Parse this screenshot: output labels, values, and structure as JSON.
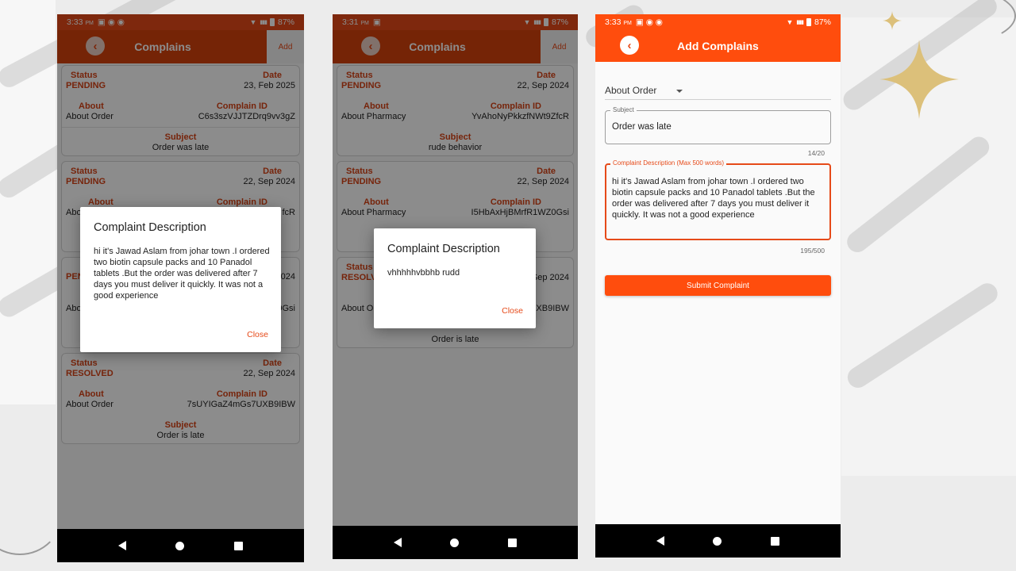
{
  "statusbar": {
    "phone1_time": "3:33",
    "phone2_time": "3:31",
    "phone3_time": "3:33",
    "period": "PM",
    "battery": "87%"
  },
  "list_screen": {
    "title": "Complains",
    "add_label": "Add",
    "labels": {
      "status": "Status",
      "date": "Date",
      "about": "About",
      "complain_id": "Complain ID",
      "subject": "Subject"
    }
  },
  "phone1": {
    "cards": [
      {
        "status": "PENDING",
        "date": "23, Feb 2025",
        "about": "About Order",
        "complain_id": "C6s3szVJJTZDrq9vv3gZ",
        "subject": "Order was late"
      },
      {
        "status": "PENDING",
        "date": "22, Sep 2024",
        "about": "Abo",
        "complain_id": "fcR",
        "subject": ""
      },
      {
        "status": "PEN",
        "date": "2024",
        "about": "Abo",
        "complain_id": "0Gsi",
        "subject": ""
      },
      {
        "status": "RESOLVED",
        "date": "22, Sep 2024",
        "about": "About Order",
        "complain_id": "7sUYIGaZ4mGs7UXB9IBW",
        "subject": "Order is late"
      }
    ],
    "dialog": {
      "title": "Complaint Description",
      "body": "hi it's Jawad Aslam from johar town .I ordered two biotin capsule packs and 10 Panadol tablets .But the order was delivered after 7 days you must deliver it quickly. It was not a good experience",
      "close_label": "Close"
    }
  },
  "phone2": {
    "cards": [
      {
        "status": "PENDING",
        "date": "22, Sep 2024",
        "about": "About Pharmacy",
        "complain_id": "YvAhoNyPkkzfNWt9ZfcR",
        "subject": "rude behavior"
      },
      {
        "status": "PENDING",
        "date": "22, Sep 2024",
        "about": "About Pharmacy",
        "complain_id": "I5HbAxHjBMrfR1WZ0Gsi",
        "subject": ""
      },
      {
        "status": "RESOLV",
        "date": "Sep 2024",
        "about": "About O",
        "complain_id": "XB9IBW",
        "subject": "Order is late"
      }
    ],
    "dialog": {
      "title": "Complaint Description",
      "body": "vhhhhhvbbhb rudd",
      "close_label": "Close"
    }
  },
  "phone3": {
    "title": "Add Complains",
    "category": "About Order",
    "subject_label": "Subject",
    "subject_value": "Order was late",
    "subject_counter": "14/20",
    "description_label": "Complaint Description (Max 500 words)",
    "description_value": "hi it's Jawad Aslam from johar town .I ordered two biotin capsule packs and 10 Panadol tablets .But the order was delivered after 7 days you must deliver it quickly. It was not a good experience",
    "description_counter": "195/500",
    "submit_label": "Submit Complaint"
  },
  "colors": {
    "accent": "#e64a19",
    "appbar_bright": "#ff4d0d"
  },
  "icons": {
    "back": "chevron-left-icon",
    "nav_back": "triangle-back-icon",
    "nav_home": "circle-home-icon",
    "nav_recent": "square-recent-icon"
  }
}
